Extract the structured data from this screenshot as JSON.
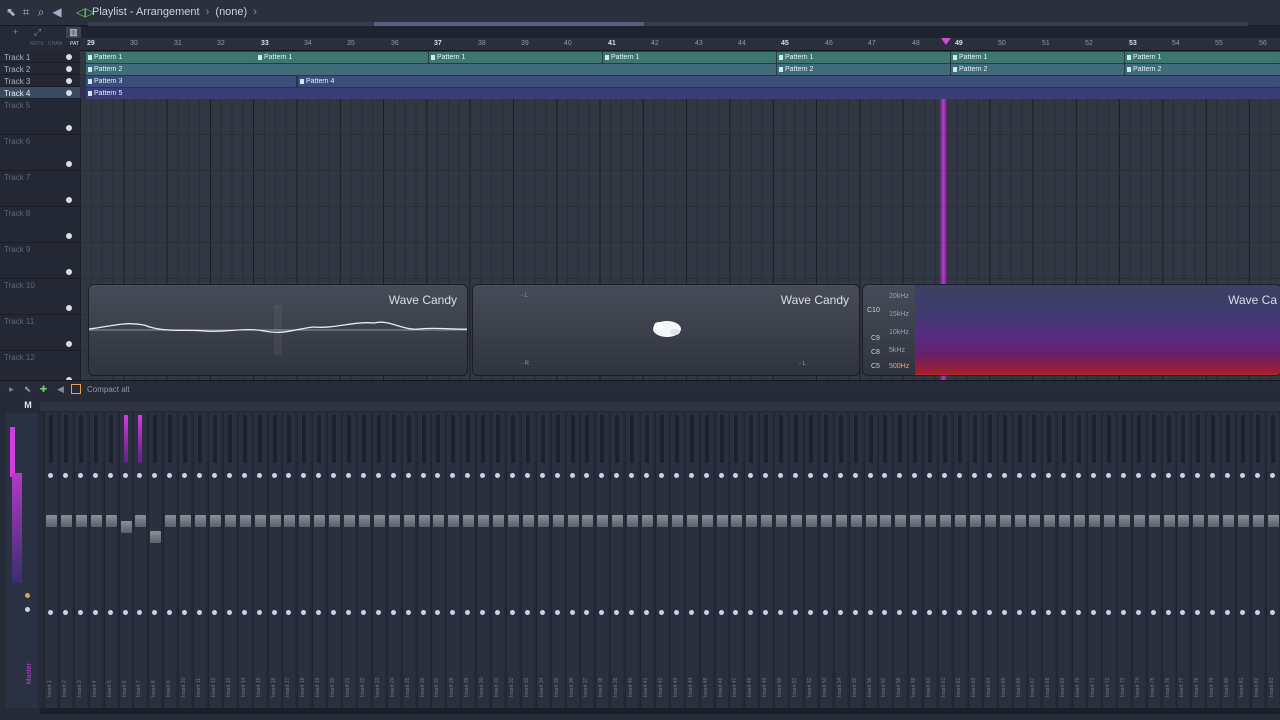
{
  "playlist": {
    "title": "Playlist - Arrangement",
    "separator": "›",
    "pattern_selector": "(none)",
    "pattern_selector_arrow": "›",
    "tools": [
      "+",
      "⤢",
      "NOTE",
      "CHAN",
      "PAT"
    ],
    "ruler": [
      "29",
      "30",
      "31",
      "32",
      "33",
      "34",
      "35",
      "36",
      "37",
      "38",
      "39",
      "40",
      "41",
      "42",
      "43",
      "44",
      "45",
      "46",
      "47",
      "48",
      "49",
      "50",
      "51",
      "52",
      "53",
      "54",
      "55",
      "56"
    ],
    "tracks": [
      "Track 1",
      "Track 2",
      "Track 3",
      "Track 4",
      "Track 5",
      "Track 6",
      "Track 7",
      "Track 8",
      "Track 9",
      "Track 10",
      "Track 11",
      "Track 12"
    ],
    "clips": {
      "pattern1": "Pattern 1",
      "pattern2": "Pattern 2",
      "pattern3": "Pattern 3",
      "pattern4": "Pattern 4",
      "pattern5": "Pattern 5"
    }
  },
  "wave_candy": {
    "title": "Wave Candy",
    "title_cut": "Wave Ca",
    "scope_l": "- L",
    "scope_r": "- R",
    "scope_l2": "- L",
    "spectrum_notes": [
      "C10",
      "C9",
      "C8",
      "C5"
    ],
    "spectrum_freqs": [
      "20kHz",
      "15kHz",
      "10kHz",
      "5kHz",
      "500Hz"
    ]
  },
  "mixer": {
    "title": "Compact alt",
    "master_button": "M",
    "master_label": "Master",
    "insert_prefix": "Insert",
    "insert_count": 83
  },
  "colors": {
    "accent": "#d33adf",
    "clip_green": "#3d7870",
    "playhead": "#b43cc6"
  }
}
